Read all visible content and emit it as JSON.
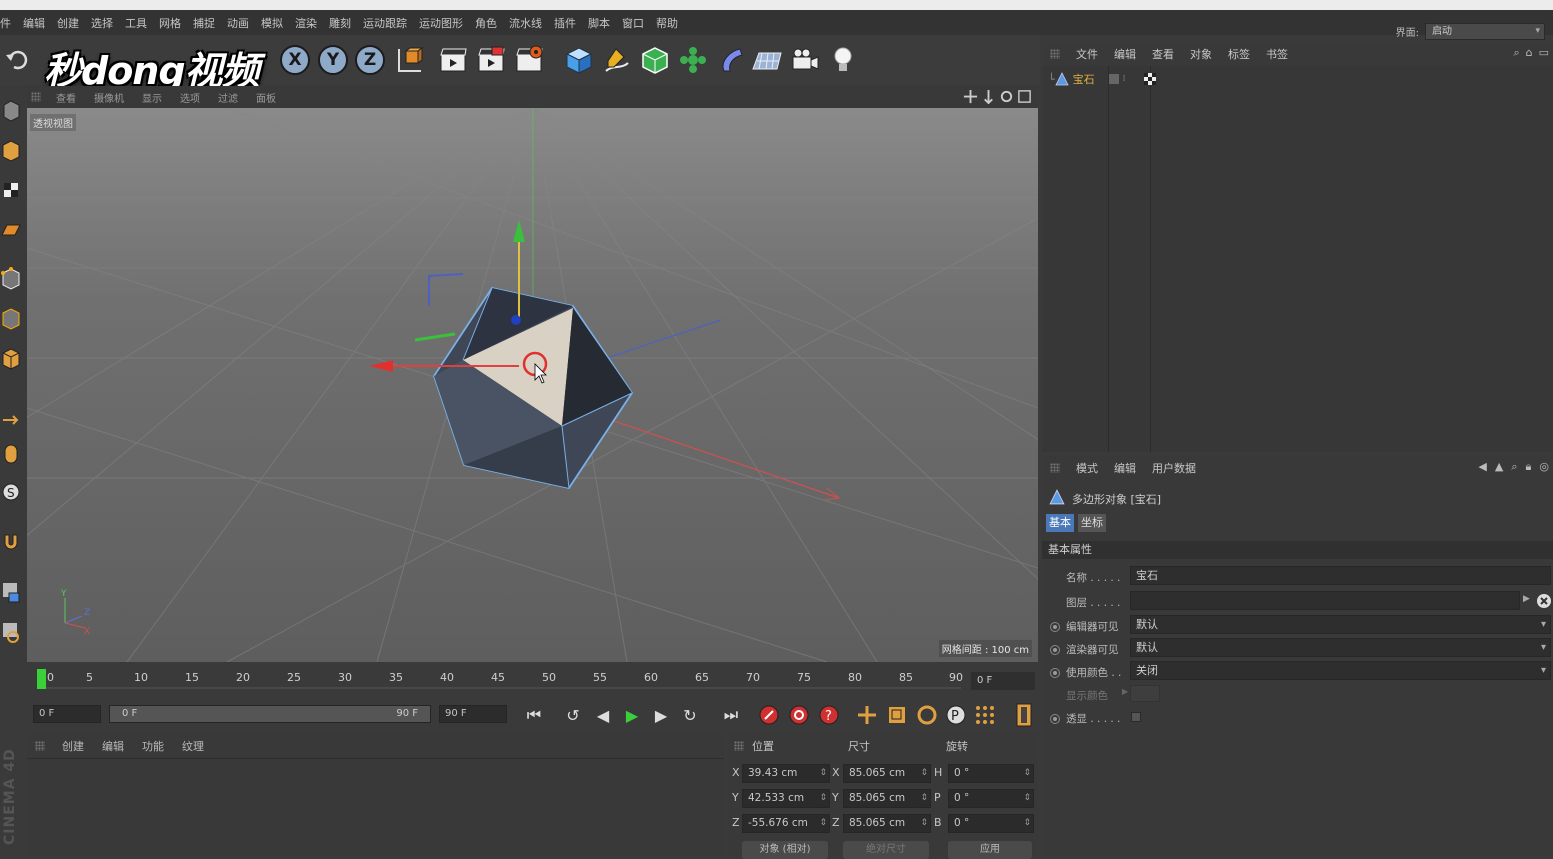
{
  "menu": {
    "items": [
      "件",
      "编辑",
      "创建",
      "选择",
      "工具",
      "网格",
      "捕捉",
      "动画",
      "模拟",
      "渲染",
      "雕刻",
      "运动跟踪",
      "运动图形",
      "角色",
      "流水线",
      "插件",
      "脚本",
      "窗口",
      "帮助"
    ],
    "layout_label": "界面:",
    "layout_value": "启动"
  },
  "watermark": "秒dong视频",
  "toolbar": {
    "axis_x": "X",
    "axis_y": "Y",
    "axis_z": "Z"
  },
  "viewport": {
    "menu": [
      "查看",
      "摄像机",
      "显示",
      "选项",
      "过滤",
      "面板"
    ],
    "label": "透视视图",
    "grid_spacing": "网格间距 : 100 cm"
  },
  "timeline": {
    "ticks": [
      "0",
      "5",
      "10",
      "15",
      "20",
      "25",
      "30",
      "35",
      "40",
      "45",
      "50",
      "55",
      "60",
      "65",
      "70",
      "75",
      "80",
      "85",
      "90"
    ],
    "current_frame": "0 F"
  },
  "transport": {
    "start_field": "0 F",
    "range_start": "0 F",
    "range_end": "90 F",
    "end_field": "90 F"
  },
  "material_panel": {
    "menu": [
      "创建",
      "编辑",
      "功能",
      "纹理"
    ]
  },
  "coord_panel": {
    "headers": {
      "position": "位置",
      "size": "尺寸",
      "rotation": "旋转"
    },
    "rows": [
      {
        "pos_axis": "X",
        "pos": "39.43 cm",
        "size_axis": "X",
        "size": "85.065 cm",
        "rot_axis": "H",
        "rot": "0 °"
      },
      {
        "pos_axis": "Y",
        "pos": "42.533 cm",
        "size_axis": "Y",
        "size": "85.065 cm",
        "rot_axis": "P",
        "rot": "0 °"
      },
      {
        "pos_axis": "Z",
        "pos": "-55.676 cm",
        "size_axis": "Z",
        "size": "85.065 cm",
        "rot_axis": "B",
        "rot": "0 °"
      }
    ],
    "mode_button": "对象 (相对)",
    "size_button": "绝对尺寸",
    "apply_button": "应用"
  },
  "object_panel": {
    "menu": [
      "文件",
      "编辑",
      "查看",
      "对象",
      "标签",
      "书签"
    ],
    "object_name": "宝石"
  },
  "attr_panel": {
    "menu": [
      "模式",
      "编辑",
      "用户数据"
    ],
    "title": "多边形对象 [宝石]",
    "tabs": [
      "基本",
      "坐标"
    ],
    "section": "基本属性",
    "fields": {
      "name_label": "名称 . . . . .",
      "name_value": "宝石",
      "layer_label": "图层 . . . . .",
      "editor_vis_label": "编辑器可见",
      "editor_vis_value": "默认",
      "render_vis_label": "渲染器可见",
      "render_vis_value": "默认",
      "use_color_label": "使用颜色 . .",
      "use_color_value": "关闭",
      "display_color_label": "显示颜色",
      "xray_label": "透显 . . . . ."
    }
  },
  "brand_vertical": "CINEMA 4D"
}
